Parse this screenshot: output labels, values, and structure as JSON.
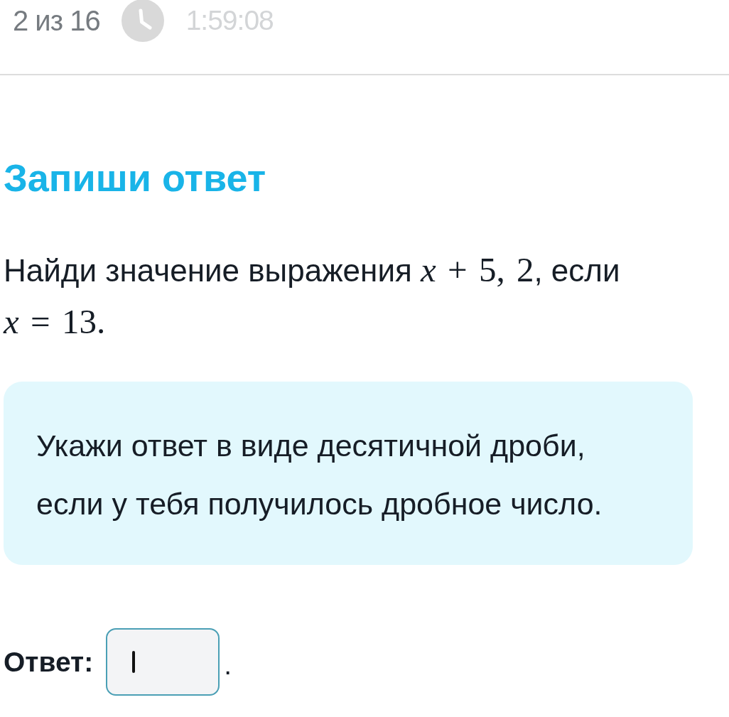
{
  "header": {
    "progress": "2 из 16",
    "timer": "1:59:08"
  },
  "title": "Запиши ответ",
  "task": [
    {
      "kind": "text",
      "text": "Найди значение выражения "
    },
    {
      "kind": "math",
      "text": "*x* + 5, 2"
    },
    {
      "kind": "text",
      "text": ", если "
    },
    {
      "kind": "math",
      "text": "*x* = 13."
    }
  ],
  "hint": {
    "lines": [
      "Укажи ответ в виде десятичной дроби,",
      "если у тебя получилось дробное число."
    ]
  },
  "answer": {
    "label": "Ответ:",
    "focused": true,
    "suffix": "."
  }
}
